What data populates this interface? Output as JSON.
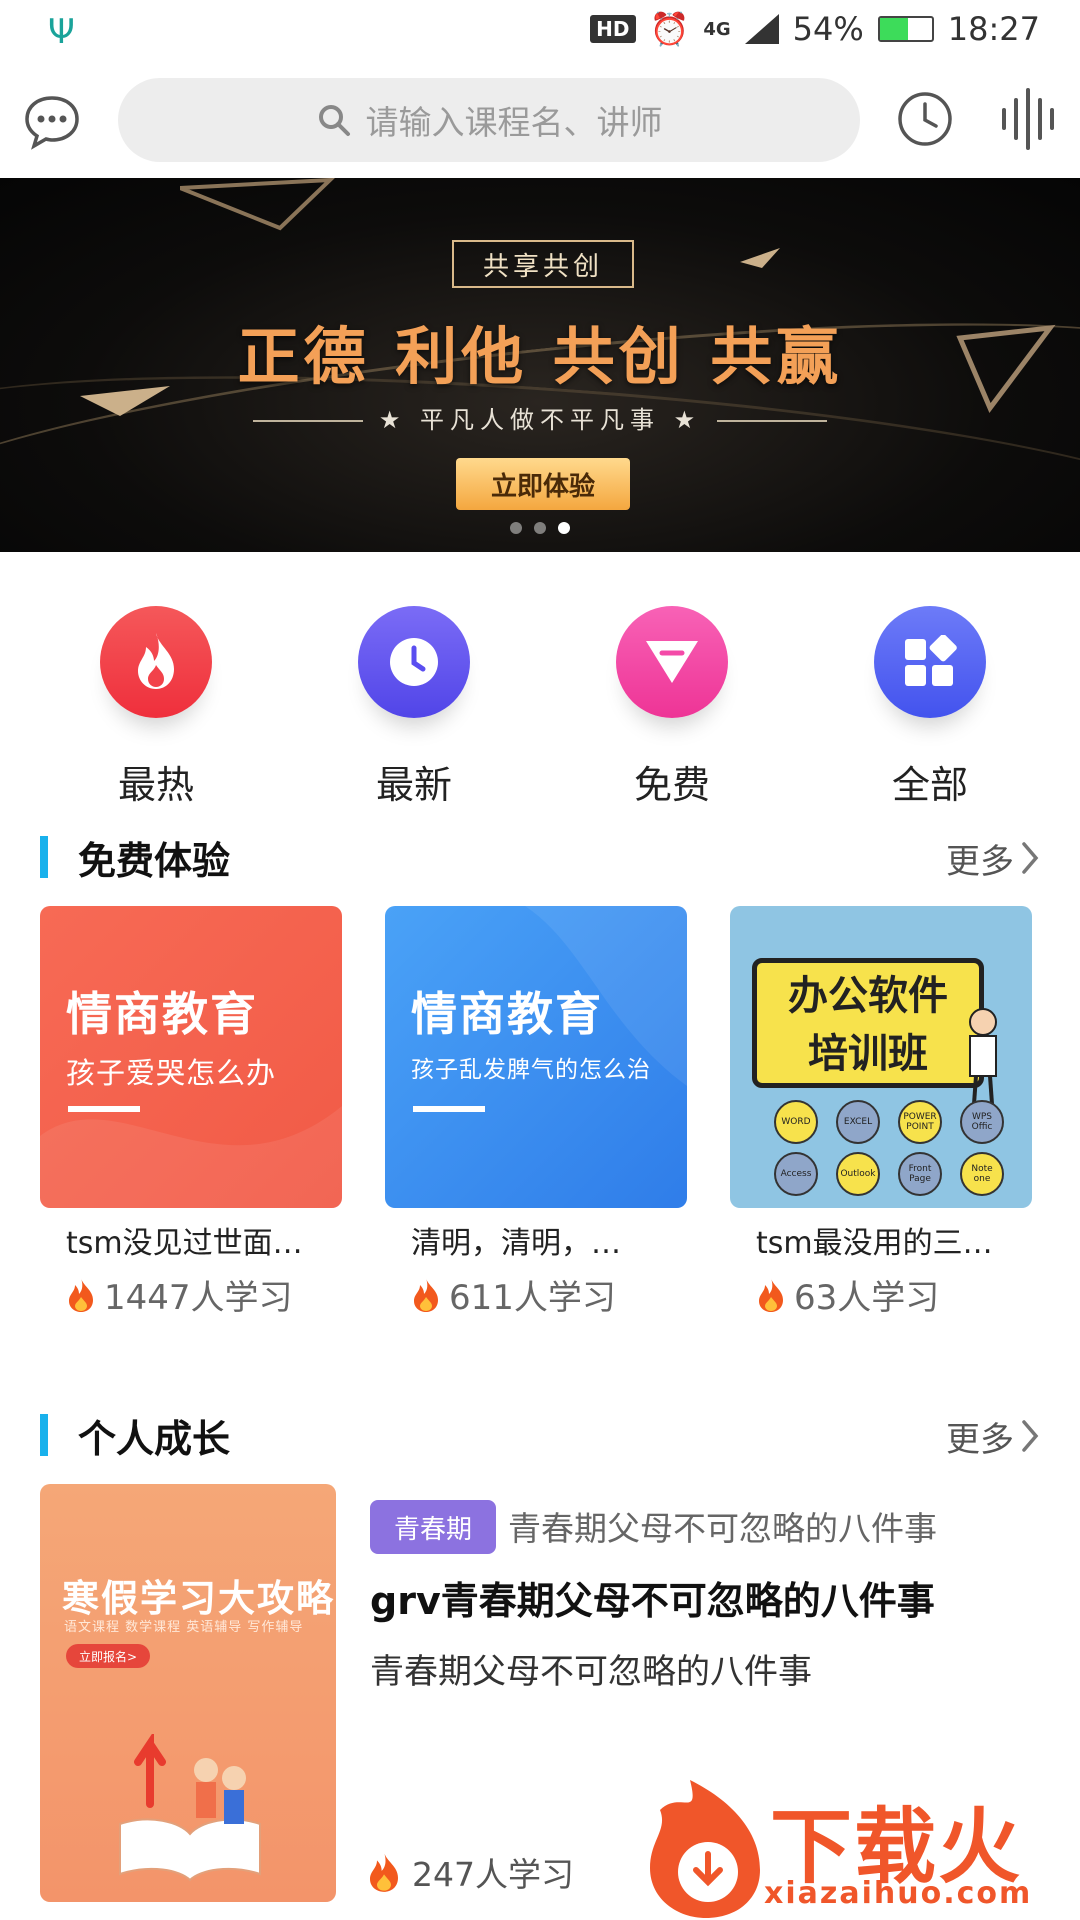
{
  "status_bar": {
    "left_icon": "trident-icon",
    "hd_badge": "HD",
    "network": "4G",
    "battery": "54%",
    "battery_level": 0.54,
    "time": "18:27"
  },
  "search": {
    "placeholder": "请输入课程名、讲师"
  },
  "banner": {
    "tag": "共享共创",
    "title": "正德 利他 共创 共赢",
    "subtitle": "★ 平凡人做不平凡事 ★",
    "button": "立即体验"
  },
  "categories": [
    {
      "label": "最热",
      "icon": "flame-icon",
      "color": "#f2424a"
    },
    {
      "label": "最新",
      "icon": "clock-icon",
      "color": "#6a5cf3"
    },
    {
      "label": "免费",
      "icon": "diamond-icon",
      "color": "#f44aa8"
    },
    {
      "label": "全部",
      "icon": "grid-icon",
      "color": "#5a6af5"
    }
  ],
  "free_section": {
    "title": "免费体验",
    "more": "更多",
    "cards": [
      {
        "thumb_title": "情商教育",
        "thumb_subtitle": "孩子爱哭怎么办",
        "name": "tsm没见过世面…",
        "learners": "1447人学习",
        "color": "#f2694f"
      },
      {
        "thumb_title": "情商教育",
        "thumb_subtitle": "孩子乱发脾气的怎么治",
        "name": "清明，清明，…",
        "learners": "611人学习",
        "color": "#3a8ef2"
      },
      {
        "thumb_title_line1": "办公软件",
        "thumb_title_line2": "培训班",
        "bubbles": [
          "WORD",
          "EXCEL",
          "POWER POINT",
          "WPS Offic",
          "Access",
          "Outlook",
          "Front Page",
          "Note one"
        ],
        "name": "tsm最没用的三…",
        "learners": "63人学习",
        "color": "#8ec3e2"
      }
    ]
  },
  "growth_section": {
    "title": "个人成长",
    "more": "更多",
    "item": {
      "thumb_title": "寒假学习大攻略",
      "thumb_subtitle": "语文课程  数学课程  英语辅导  写作辅导",
      "thumb_button": "立即报名>",
      "tag": "青春期",
      "subtitle": "青春期父母不可忽略的八件事",
      "title": "grv青春期父母不可忽略的八件事",
      "description": "青春期父母不可忽略的八件事",
      "learners": "247人学习"
    }
  },
  "watermark": {
    "text": "下载火",
    "url": "xiazaihuo.com"
  }
}
